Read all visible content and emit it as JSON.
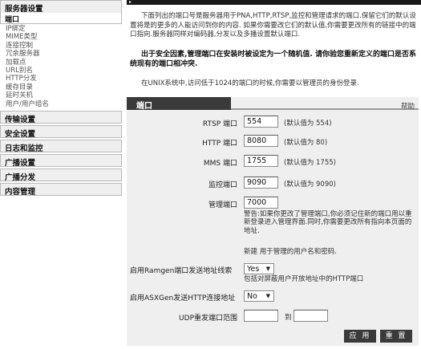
{
  "sidebar": {
    "current_group": "服务器设置",
    "current_item": "端口",
    "sub_items": [
      "IP绑定",
      "MIME类型",
      "连接控制",
      "冗余服务器",
      "加载点",
      "URL别名",
      "HTTP分发",
      "缓存目录",
      "延时关机",
      "用户/用户组名"
    ],
    "groups": [
      "传输设置",
      "安全设置",
      "日志和监控",
      "广播设置",
      "广播分发",
      "内容管理"
    ]
  },
  "intro": "下面列出的端口号是服务器用于PNA,HTTP,RTSP,监控和管理请求的端口.保留它们的默认设置将是的更多的人能访问到你的内容. 如果你需要改它们的默认值,你需要更改所有的链接中的端口指向.服务器同样对编码器,分发以及多播设置默认端口.",
  "warning": "出于安全因素,管理端口在安装时被设定为一个随机值. 请你验您重新定义的端口是否系统现有的端口相冲突.",
  "note": "在UNIX系统中,访问低于1024的端口的时候,你需要以管理员的身份登录.",
  "panel": {
    "title": "端口",
    "help": "帮助",
    "rtsp": {
      "label": "RTSP 端口",
      "value": "554",
      "default": "(默认值为 554)"
    },
    "http": {
      "label": "HTTP 端口",
      "value": "8080",
      "default": "(默认值为 80)"
    },
    "mms": {
      "label": "MMS 端口",
      "value": "1755",
      "default": "(默认值为 1755)"
    },
    "monitor": {
      "label": "监控端口",
      "value": "9090",
      "default": "(默认值为 9090)"
    },
    "admin": {
      "label": "管理端口",
      "value": "7000",
      "warning": "警告:如果你更改了管理端口,你必须记住新的端口用以重新登录进入管理界面.同时,你需要更改所有指向本页面的地址.",
      "new_user": "新建 用于管理的用户名和密码."
    },
    "ramgen": {
      "label": "启用Ramgen端口发送地址线索",
      "value": "Yes",
      "hint": "包括对屏蔽用户开放地址中的HTTP端口"
    },
    "asxgen": {
      "label": "启用ASXGen发送HTTP连接地址",
      "value": "No"
    },
    "udp": {
      "label": "UDP重发端口范围",
      "from": "",
      "to_label": "到",
      "to": ""
    },
    "apply": "应 用",
    "reset": "重 置"
  }
}
